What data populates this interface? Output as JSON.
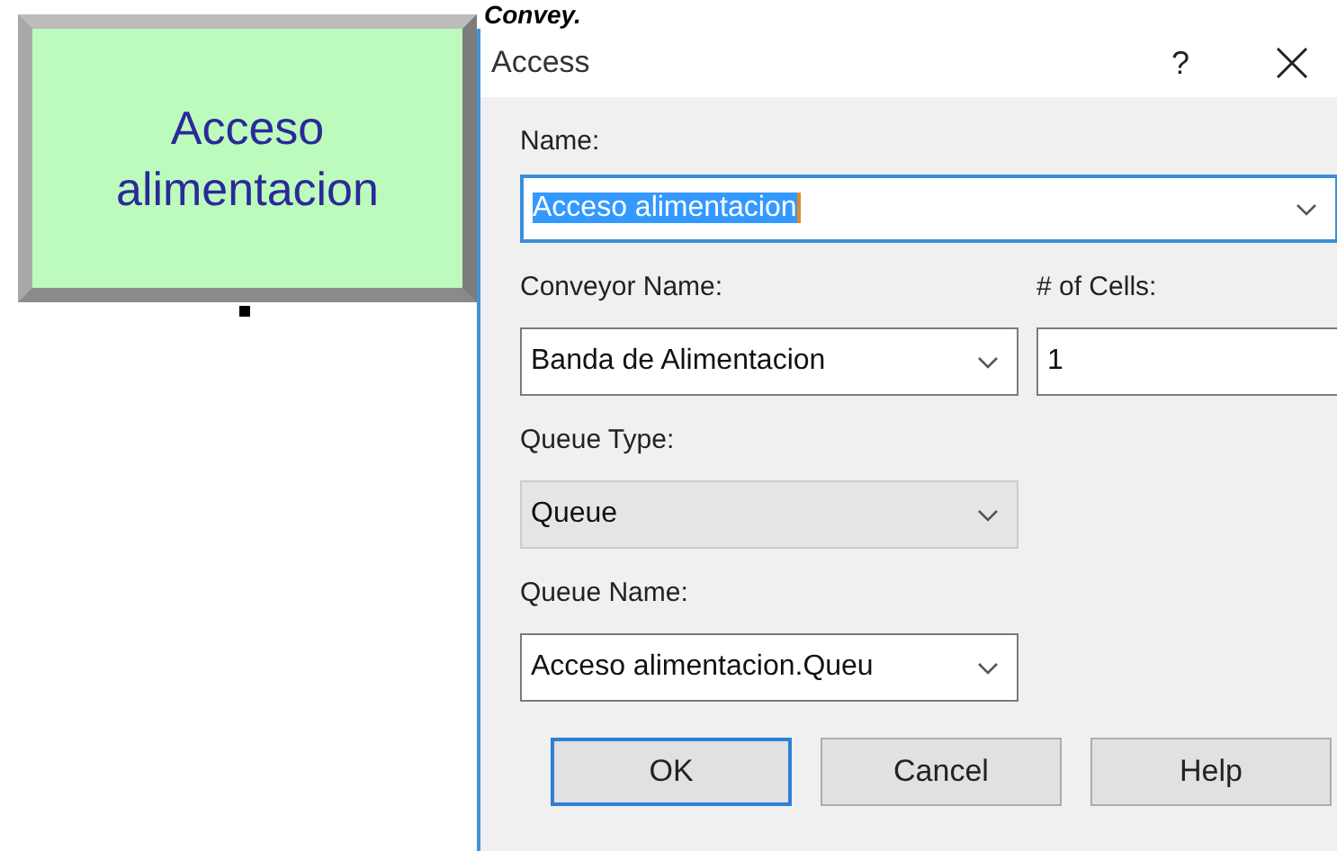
{
  "caption": "Convey.",
  "module": {
    "label": "Acceso alimentacion"
  },
  "dialog": {
    "title": "Access",
    "help": "?",
    "fields": [
      {
        "label": "Name:",
        "kind": "combo",
        "value": "Acceso alimentacion",
        "text_selected": true
      },
      {
        "label": "Conveyor Name:",
        "kind": "combo",
        "value": "Banda de Alimentacion",
        "text_selected": false
      },
      {
        "label": "# of Cells:",
        "kind": "text",
        "value": "1",
        "text_selected": false
      },
      {
        "label": "Queue Type:",
        "kind": "dropdown-list",
        "value": "Queue",
        "text_selected": false
      },
      {
        "label": "Queue Name:",
        "kind": "combo",
        "value": "Acceso alimentacion.Queu",
        "text_selected": false
      }
    ],
    "buttons": [
      {
        "label": "OK",
        "default": true
      },
      {
        "label": "Cancel",
        "default": false
      },
      {
        "label": "Help",
        "default": false
      }
    ]
  }
}
